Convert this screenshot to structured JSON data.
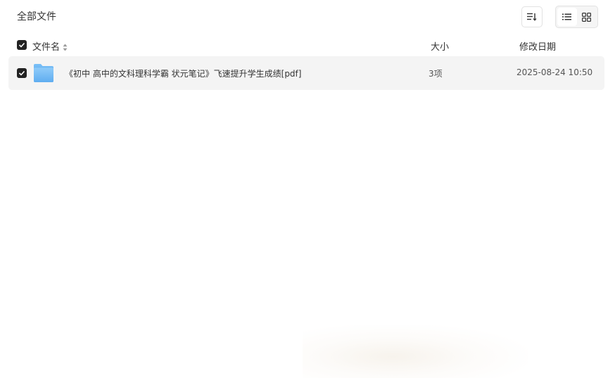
{
  "header": {
    "title": "全部文件"
  },
  "toolbar": {
    "sort_icon": "sort-list-icon",
    "view_modes": [
      {
        "name": "list",
        "icon": "list-view-icon",
        "active": true
      },
      {
        "name": "grid",
        "icon": "grid-view-icon",
        "active": false
      }
    ]
  },
  "columns": {
    "name": "文件名",
    "size": "大小",
    "date": "修改日期"
  },
  "files": [
    {
      "name": "《初中 高中的文科理科学霸 状元笔记》飞速提升学生成绩[pdf]",
      "size": "3项",
      "modified": "2025-08-24 10:50",
      "type": "folder",
      "checked": true
    }
  ],
  "colors": {
    "checkbox": "#222222",
    "row_bg": "#f4f4f4",
    "folder": "#5aa8ef"
  }
}
